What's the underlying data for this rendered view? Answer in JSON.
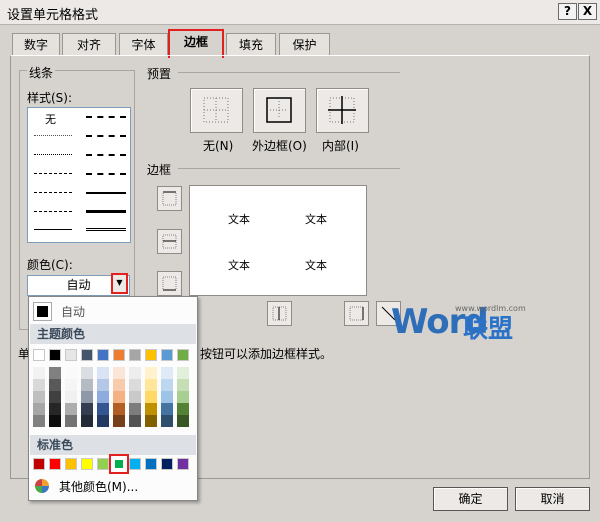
{
  "window": {
    "title": "设置单元格格式",
    "help_label": "?",
    "close_label": "X"
  },
  "tabs": [
    {
      "label": "数字"
    },
    {
      "label": "对齐"
    },
    {
      "label": "字体"
    },
    {
      "label": "边框"
    },
    {
      "label": "填充"
    },
    {
      "label": "保护"
    }
  ],
  "line_group": {
    "title": "线条",
    "style_label": "样式(S):",
    "none_label": "无",
    "color_label": "颜色(C):",
    "color_value": "自动"
  },
  "preset_group": {
    "title": "预置",
    "none": "无(N)",
    "outline": "外边框(O)",
    "inside": "内部(I)"
  },
  "border_group": {
    "title": "边框",
    "cell_text": "文本"
  },
  "hint_left": "单",
  "hint_right": "按钮可以添加边框样式。",
  "color_popup": {
    "auto_label": "自动",
    "theme_title": "主题颜色",
    "standard_title": "标准色",
    "more_label": "其他颜色(M)...",
    "theme_colors": [
      "#ffffff",
      "#000000",
      "#eeece1",
      "#1f497d",
      "#4f81bd",
      "#c0504d",
      "#9bbb59",
      "#8064a2",
      "#4bacc6",
      "#f79646"
    ],
    "theme_colors_actual": [
      "#ffffff",
      "#000000",
      "#e7e6e6",
      "#44546a",
      "#4472c4",
      "#ed7d31",
      "#a5a5a5",
      "#ffc000",
      "#5b9bd5",
      "#70ad47"
    ],
    "standard_colors": [
      "#c00000",
      "#ff0000",
      "#ffc000",
      "#ffff00",
      "#92d050",
      "#00b050",
      "#00b0f0",
      "#0070c0",
      "#002060",
      "#7030a0"
    ],
    "selected_standard_index": 5
  },
  "buttons": {
    "ok": "确定",
    "cancel": "取消"
  },
  "watermark": {
    "brand": "Word",
    "brand_cn": "联盟",
    "url": "www.wordlm.com"
  }
}
